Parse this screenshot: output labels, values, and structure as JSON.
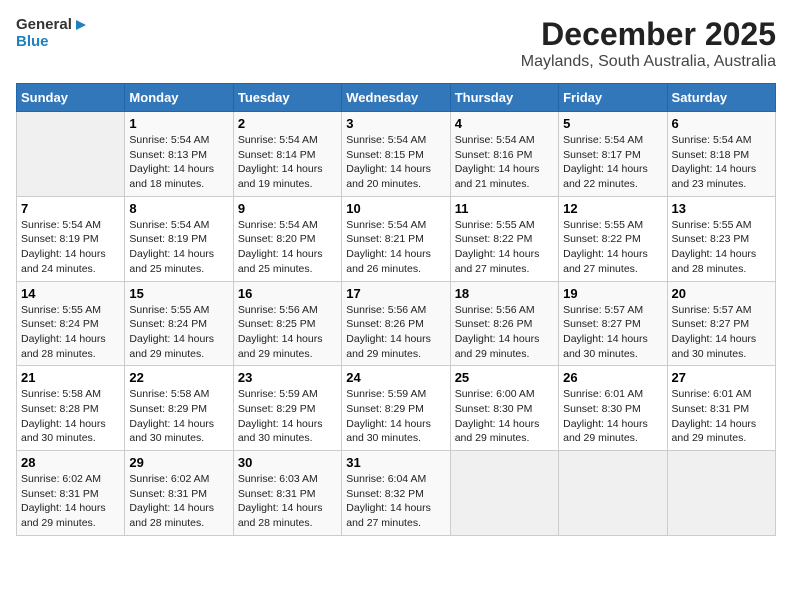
{
  "logo": {
    "line1": "General",
    "line2": "Blue"
  },
  "title": "December 2025",
  "subtitle": "Maylands, South Australia, Australia",
  "weekdays": [
    "Sunday",
    "Monday",
    "Tuesday",
    "Wednesday",
    "Thursday",
    "Friday",
    "Saturday"
  ],
  "weeks": [
    [
      {
        "day": "",
        "sunrise": "",
        "sunset": "",
        "daylight": ""
      },
      {
        "day": "1",
        "sunrise": "Sunrise: 5:54 AM",
        "sunset": "Sunset: 8:13 PM",
        "daylight": "Daylight: 14 hours and 18 minutes."
      },
      {
        "day": "2",
        "sunrise": "Sunrise: 5:54 AM",
        "sunset": "Sunset: 8:14 PM",
        "daylight": "Daylight: 14 hours and 19 minutes."
      },
      {
        "day": "3",
        "sunrise": "Sunrise: 5:54 AM",
        "sunset": "Sunset: 8:15 PM",
        "daylight": "Daylight: 14 hours and 20 minutes."
      },
      {
        "day": "4",
        "sunrise": "Sunrise: 5:54 AM",
        "sunset": "Sunset: 8:16 PM",
        "daylight": "Daylight: 14 hours and 21 minutes."
      },
      {
        "day": "5",
        "sunrise": "Sunrise: 5:54 AM",
        "sunset": "Sunset: 8:17 PM",
        "daylight": "Daylight: 14 hours and 22 minutes."
      },
      {
        "day": "6",
        "sunrise": "Sunrise: 5:54 AM",
        "sunset": "Sunset: 8:18 PM",
        "daylight": "Daylight: 14 hours and 23 minutes."
      }
    ],
    [
      {
        "day": "7",
        "sunrise": "Sunrise: 5:54 AM",
        "sunset": "Sunset: 8:19 PM",
        "daylight": "Daylight: 14 hours and 24 minutes."
      },
      {
        "day": "8",
        "sunrise": "Sunrise: 5:54 AM",
        "sunset": "Sunset: 8:19 PM",
        "daylight": "Daylight: 14 hours and 25 minutes."
      },
      {
        "day": "9",
        "sunrise": "Sunrise: 5:54 AM",
        "sunset": "Sunset: 8:20 PM",
        "daylight": "Daylight: 14 hours and 25 minutes."
      },
      {
        "day": "10",
        "sunrise": "Sunrise: 5:54 AM",
        "sunset": "Sunset: 8:21 PM",
        "daylight": "Daylight: 14 hours and 26 minutes."
      },
      {
        "day": "11",
        "sunrise": "Sunrise: 5:55 AM",
        "sunset": "Sunset: 8:22 PM",
        "daylight": "Daylight: 14 hours and 27 minutes."
      },
      {
        "day": "12",
        "sunrise": "Sunrise: 5:55 AM",
        "sunset": "Sunset: 8:22 PM",
        "daylight": "Daylight: 14 hours and 27 minutes."
      },
      {
        "day": "13",
        "sunrise": "Sunrise: 5:55 AM",
        "sunset": "Sunset: 8:23 PM",
        "daylight": "Daylight: 14 hours and 28 minutes."
      }
    ],
    [
      {
        "day": "14",
        "sunrise": "Sunrise: 5:55 AM",
        "sunset": "Sunset: 8:24 PM",
        "daylight": "Daylight: 14 hours and 28 minutes."
      },
      {
        "day": "15",
        "sunrise": "Sunrise: 5:55 AM",
        "sunset": "Sunset: 8:24 PM",
        "daylight": "Daylight: 14 hours and 29 minutes."
      },
      {
        "day": "16",
        "sunrise": "Sunrise: 5:56 AM",
        "sunset": "Sunset: 8:25 PM",
        "daylight": "Daylight: 14 hours and 29 minutes."
      },
      {
        "day": "17",
        "sunrise": "Sunrise: 5:56 AM",
        "sunset": "Sunset: 8:26 PM",
        "daylight": "Daylight: 14 hours and 29 minutes."
      },
      {
        "day": "18",
        "sunrise": "Sunrise: 5:56 AM",
        "sunset": "Sunset: 8:26 PM",
        "daylight": "Daylight: 14 hours and 29 minutes."
      },
      {
        "day": "19",
        "sunrise": "Sunrise: 5:57 AM",
        "sunset": "Sunset: 8:27 PM",
        "daylight": "Daylight: 14 hours and 30 minutes."
      },
      {
        "day": "20",
        "sunrise": "Sunrise: 5:57 AM",
        "sunset": "Sunset: 8:27 PM",
        "daylight": "Daylight: 14 hours and 30 minutes."
      }
    ],
    [
      {
        "day": "21",
        "sunrise": "Sunrise: 5:58 AM",
        "sunset": "Sunset: 8:28 PM",
        "daylight": "Daylight: 14 hours and 30 minutes."
      },
      {
        "day": "22",
        "sunrise": "Sunrise: 5:58 AM",
        "sunset": "Sunset: 8:29 PM",
        "daylight": "Daylight: 14 hours and 30 minutes."
      },
      {
        "day": "23",
        "sunrise": "Sunrise: 5:59 AM",
        "sunset": "Sunset: 8:29 PM",
        "daylight": "Daylight: 14 hours and 30 minutes."
      },
      {
        "day": "24",
        "sunrise": "Sunrise: 5:59 AM",
        "sunset": "Sunset: 8:29 PM",
        "daylight": "Daylight: 14 hours and 30 minutes."
      },
      {
        "day": "25",
        "sunrise": "Sunrise: 6:00 AM",
        "sunset": "Sunset: 8:30 PM",
        "daylight": "Daylight: 14 hours and 29 minutes."
      },
      {
        "day": "26",
        "sunrise": "Sunrise: 6:01 AM",
        "sunset": "Sunset: 8:30 PM",
        "daylight": "Daylight: 14 hours and 29 minutes."
      },
      {
        "day": "27",
        "sunrise": "Sunrise: 6:01 AM",
        "sunset": "Sunset: 8:31 PM",
        "daylight": "Daylight: 14 hours and 29 minutes."
      }
    ],
    [
      {
        "day": "28",
        "sunrise": "Sunrise: 6:02 AM",
        "sunset": "Sunset: 8:31 PM",
        "daylight": "Daylight: 14 hours and 29 minutes."
      },
      {
        "day": "29",
        "sunrise": "Sunrise: 6:02 AM",
        "sunset": "Sunset: 8:31 PM",
        "daylight": "Daylight: 14 hours and 28 minutes."
      },
      {
        "day": "30",
        "sunrise": "Sunrise: 6:03 AM",
        "sunset": "Sunset: 8:31 PM",
        "daylight": "Daylight: 14 hours and 28 minutes."
      },
      {
        "day": "31",
        "sunrise": "Sunrise: 6:04 AM",
        "sunset": "Sunset: 8:32 PM",
        "daylight": "Daylight: 14 hours and 27 minutes."
      },
      {
        "day": "",
        "sunrise": "",
        "sunset": "",
        "daylight": ""
      },
      {
        "day": "",
        "sunrise": "",
        "sunset": "",
        "daylight": ""
      },
      {
        "day": "",
        "sunrise": "",
        "sunset": "",
        "daylight": ""
      }
    ]
  ]
}
